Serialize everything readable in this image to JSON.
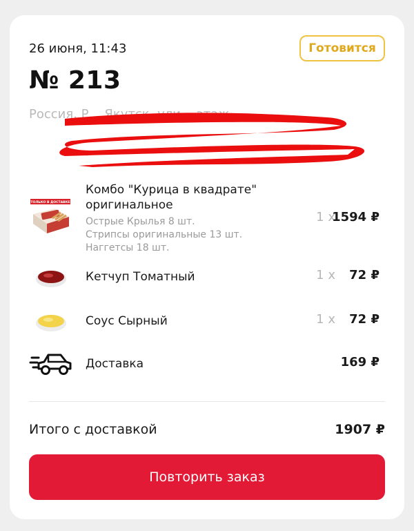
{
  "order": {
    "date": "26 июня, 11:43",
    "status": "Готовится",
    "number": "№ 213",
    "address": "Россия, Р... Якутск, ули... этаж ..."
  },
  "items": [
    {
      "name": "Комбо \"Курица в квадрате\" оригинальное",
      "badge": "ТОЛЬКО В ДОСТАВКЕ",
      "details": [
        "Острые Крылья 8 шт.",
        "Стрипсы оригинальные 13 шт.",
        "Наггетсы 18 шт."
      ],
      "qty": "1 x",
      "price": "1594 ₽"
    },
    {
      "name": "Кетчуп Томатный",
      "qty": "1 x",
      "price": "72 ₽"
    },
    {
      "name": "Соус Сырный",
      "qty": "1 x",
      "price": "72 ₽"
    },
    {
      "name": "Доставка",
      "price": "169 ₽",
      "icon": "delivery-car-icon"
    }
  ],
  "total": {
    "label": "Итого с доставкой",
    "value": "1907 ₽"
  },
  "actions": {
    "repeat_label": "Повторить заказ"
  },
  "colors": {
    "accent": "#e21a36",
    "status": "#e0a91d"
  }
}
